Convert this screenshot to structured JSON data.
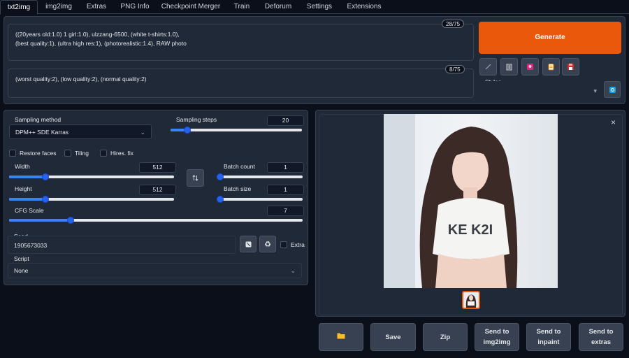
{
  "tabs": [
    "txt2img",
    "img2img",
    "Extras",
    "PNG Info",
    "Checkpoint Merger",
    "Train",
    "Deforum",
    "Settings",
    "Extensions"
  ],
  "prompt": {
    "text": "((20years old:1.0) 1 girl:1.0), ulzzang-6500, (white t-shirts:1.0),\n(best quality:1), (ultra high res:1), (photorealistic:1.4), RAW photo",
    "counter": "28/75"
  },
  "negative_prompt": {
    "text": "(worst quality:2), (low quality:2), (normal quality:2)",
    "counter": "8/75"
  },
  "generate_label": "Generate",
  "styles": {
    "label": "Styles",
    "value": ""
  },
  "tool_icons": [
    "pencil-icon",
    "trash-icon",
    "image-icon",
    "clipboard-icon",
    "save-disk-icon"
  ],
  "sampling": {
    "method_label": "Sampling method",
    "method_value": "DPM++ SDE Karras",
    "steps_label": "Sampling steps",
    "steps_value": "20",
    "steps_fraction": 0.13
  },
  "checkboxes": {
    "restore_faces": "Restore faces",
    "tiling": "Tiling",
    "hires_fix": "Hires. fix"
  },
  "width": {
    "label": "Width",
    "value": "512",
    "fraction": 0.22
  },
  "height": {
    "label": "Height",
    "value": "512",
    "fraction": 0.22
  },
  "batch_count": {
    "label": "Batch count",
    "value": "1",
    "fraction": 0.0
  },
  "batch_size": {
    "label": "Batch size",
    "value": "1",
    "fraction": 0.0
  },
  "cfg_scale": {
    "label": "CFG Scale",
    "value": "7",
    "fraction": 0.21
  },
  "seed": {
    "label": "Seed",
    "value": "1905673033",
    "extra_label": "Extra"
  },
  "script": {
    "label": "Script",
    "value": "None"
  },
  "output_image": {
    "shirt_text": "KE K2I",
    "close_symbol": "×"
  },
  "actions": {
    "folder": "",
    "save": "Save",
    "zip": "Zip",
    "send_img2img": "Send to\nimg2img",
    "send_inpaint": "Send to\ninpaint",
    "send_extras": "Send to\nextras"
  },
  "colors": {
    "accent": "#ea580c",
    "slider": "#3b82f6",
    "bg": "#0b0f19",
    "panel": "#1f2937"
  }
}
